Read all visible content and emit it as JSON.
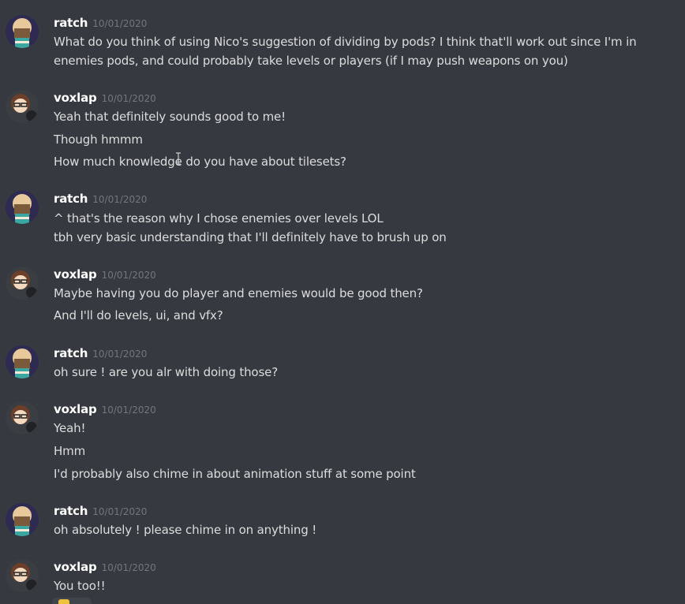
{
  "colors": {
    "background": "#36393f",
    "username": "#ffffff",
    "timestamp": "#72767d",
    "text": "#dcddde"
  },
  "messages": [
    {
      "author": "ratch",
      "timestamp": "10/01/2020",
      "avatar": "ratch-avatar",
      "lines": [
        "What do you think of using Nico's suggestion of dividing by pods? I think that'll work out since I'm in",
        "enemies pods, and could probably take levels or players (if I may push weapons on  you)"
      ]
    },
    {
      "author": "voxlap",
      "timestamp": "10/01/2020",
      "avatar": "voxlap-avatar",
      "lines": [
        "Yeah that definitely sounds good to me!",
        "Though hmmm",
        "How much knowledge do you have about tilesets?"
      ]
    },
    {
      "author": "ratch",
      "timestamp": "10/01/2020",
      "avatar": "ratch-avatar",
      "lines": [
        "^ that's the reason why I  chose  enemies over levels LOL",
        "tbh very basic understanding that I'll definitely have to brush up on"
      ]
    },
    {
      "author": "voxlap",
      "timestamp": "10/01/2020",
      "avatar": "voxlap-avatar",
      "lines": [
        "Maybe having you do player and enemies would be good then?",
        "And I'll do levels, ui, and vfx?"
      ]
    },
    {
      "author": "ratch",
      "timestamp": "10/01/2020",
      "avatar": "ratch-avatar",
      "lines": [
        "oh sure ! are you alr with doing those?"
      ]
    },
    {
      "author": "voxlap",
      "timestamp": "10/01/2020",
      "avatar": "voxlap-avatar",
      "lines": [
        "Yeah!",
        "Hmm",
        "I'd probably also chime in about animation stuff at some point"
      ]
    },
    {
      "author": "ratch",
      "timestamp": "10/01/2020",
      "avatar": "ratch-avatar",
      "lines": [
        "oh absolutely ! please chime in on anything !"
      ]
    },
    {
      "author": "voxlap",
      "timestamp": "10/01/2020",
      "avatar": "voxlap-avatar",
      "lines": [
        "You too!!"
      ],
      "reaction": {
        "emoji": "thumbs-up-icon"
      }
    }
  ]
}
